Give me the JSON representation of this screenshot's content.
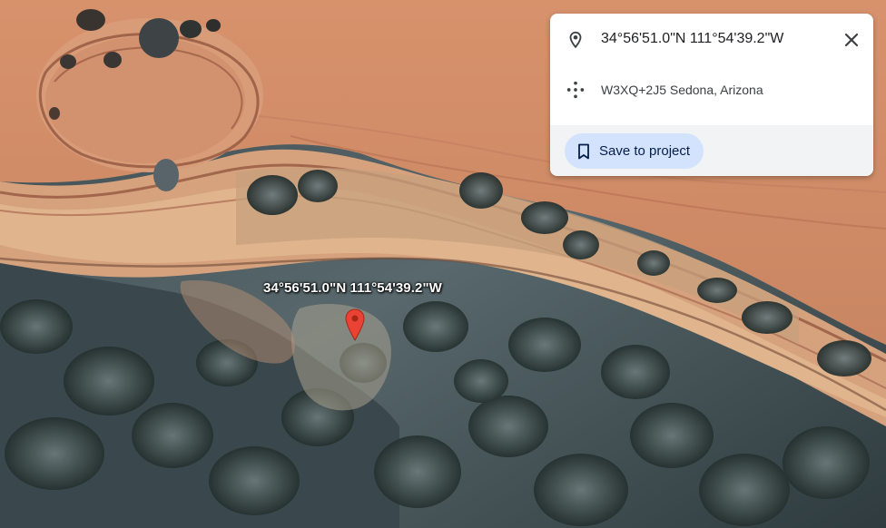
{
  "map": {
    "type": "satellite",
    "marker_label": "34°56'51.0\"N 111°54'39.2\"W"
  },
  "info_card": {
    "coordinates": "34°56'51.0\"N 111°54'39.2\"W",
    "plus_code": "W3XQ+2J5 Sedona, Arizona",
    "save_button_label": "Save to project",
    "icons": {
      "location": "location-pin-icon",
      "plus_code": "plus-code-icon",
      "close": "close-icon",
      "save": "bookmark-icon"
    }
  },
  "colors": {
    "marker": "#ea4335",
    "button_bg": "#d3e3fd",
    "button_text": "#041e49",
    "card_footer": "#f1f3f4"
  }
}
